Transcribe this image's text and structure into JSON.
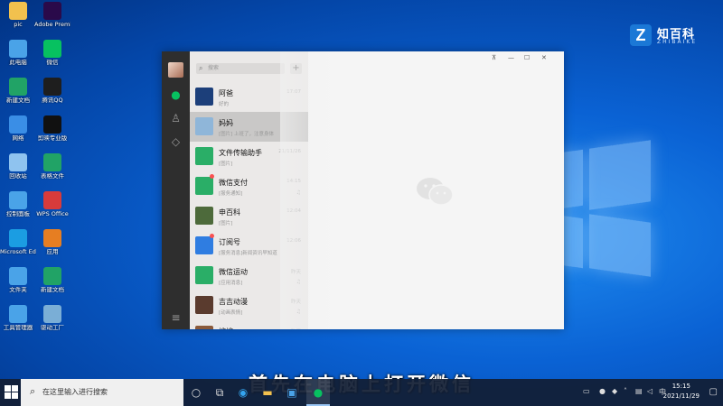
{
  "desktop_icons": [
    {
      "name": "desktop-icon-pic",
      "label": "pic",
      "color": "#f2c14e"
    },
    {
      "name": "desktop-icon-premiere",
      "label": "Adobe Premiere Pr...",
      "color": "#2a0a4a"
    },
    {
      "name": "desktop-icon-computer",
      "label": "此电脑",
      "color": "#4aa3e8"
    },
    {
      "name": "desktop-icon-wechat",
      "label": "微信",
      "color": "#07c160"
    },
    {
      "name": "desktop-icon-doc1",
      "label": "新建文档",
      "color": "#21a366"
    },
    {
      "name": "desktop-icon-qq",
      "label": "腾讯QQ",
      "color": "#1e1e1e"
    },
    {
      "name": "desktop-icon-network",
      "label": "网络",
      "color": "#3a8ee6"
    },
    {
      "name": "desktop-icon-capcut",
      "label": "剪映专业版",
      "color": "#111111"
    },
    {
      "name": "desktop-icon-recycle",
      "label": "回收站",
      "color": "#8fc3ef"
    },
    {
      "name": "desktop-icon-sheet",
      "label": "表格文件",
      "color": "#21a366"
    },
    {
      "name": "desktop-icon-control",
      "label": "控制面板",
      "color": "#4aa3e8"
    },
    {
      "name": "desktop-icon-wps",
      "label": "WPS Office",
      "color": "#d83b3b"
    },
    {
      "name": "desktop-icon-edge",
      "label": "Microsoft Edge",
      "color": "#1b9de2"
    },
    {
      "name": "desktop-icon-app",
      "label": "应用",
      "color": "#e67e22"
    },
    {
      "name": "desktop-icon-folder",
      "label": "文件夹",
      "color": "#4aa3e8"
    },
    {
      "name": "desktop-icon-doc2",
      "label": "新建文档",
      "color": "#21a366"
    },
    {
      "name": "desktop-icon-tool",
      "label": "工具管理器",
      "color": "#4aa3e8"
    },
    {
      "name": "desktop-icon-driver",
      "label": "驱动工厂",
      "color": "#7aaed6"
    }
  ],
  "watermark": {
    "logo": "Z",
    "title": "知百科",
    "subtitle": "ZHIBAIKE"
  },
  "wechat": {
    "search_placeholder": "搜索",
    "plus": "+",
    "window_controls": {
      "pin": "⊼",
      "min": "—",
      "max": "☐",
      "close": "✕"
    },
    "chats": [
      {
        "name": "阿爸",
        "preview": "好的",
        "time": "17:07",
        "color": "#1c3f7a",
        "unread": false,
        "muted": false,
        "selected": false
      },
      {
        "name": "妈妈",
        "preview": "[图片] 上班了，注意身体",
        "time": "",
        "color": "#8fb6d9",
        "unread": false,
        "muted": false,
        "selected": true
      },
      {
        "name": "文件传输助手",
        "preview": "[图片]",
        "time": "21/11/26",
        "color": "#2aae67",
        "unread": false,
        "muted": false,
        "selected": false
      },
      {
        "name": "微信支付",
        "preview": "[服务通知]",
        "time": "14:15",
        "color": "#2aae67",
        "unread": true,
        "muted": true,
        "selected": false
      },
      {
        "name": "申百科",
        "preview": "[图片]",
        "time": "12:04",
        "color": "#4d6a3b",
        "unread": false,
        "muted": false,
        "selected": false
      },
      {
        "name": "订阅号",
        "preview": "[服务消息]新闻资讯早知道",
        "time": "12:06",
        "color": "#2f7de1",
        "unread": true,
        "muted": false,
        "selected": false
      },
      {
        "name": "微信运动",
        "preview": "[应用消息]",
        "time": "昨天",
        "color": "#2aae67",
        "unread": false,
        "muted": true,
        "selected": false
      },
      {
        "name": "吉吉动漫",
        "preview": "[动画表情]",
        "time": "昨天",
        "color": "#5a3b2e",
        "unread": false,
        "muted": true,
        "selected": false
      },
      {
        "name": "嫂嫂",
        "preview": "",
        "time": "昨天",
        "color": "#8a5a3b",
        "unread": false,
        "muted": false,
        "selected": false
      }
    ]
  },
  "caption": "首先在电脑上打开微信",
  "taskbar": {
    "search_placeholder": "在这里输入进行搜索",
    "tray_ime": "中",
    "time": "15:15",
    "date": "2021/11/29"
  }
}
